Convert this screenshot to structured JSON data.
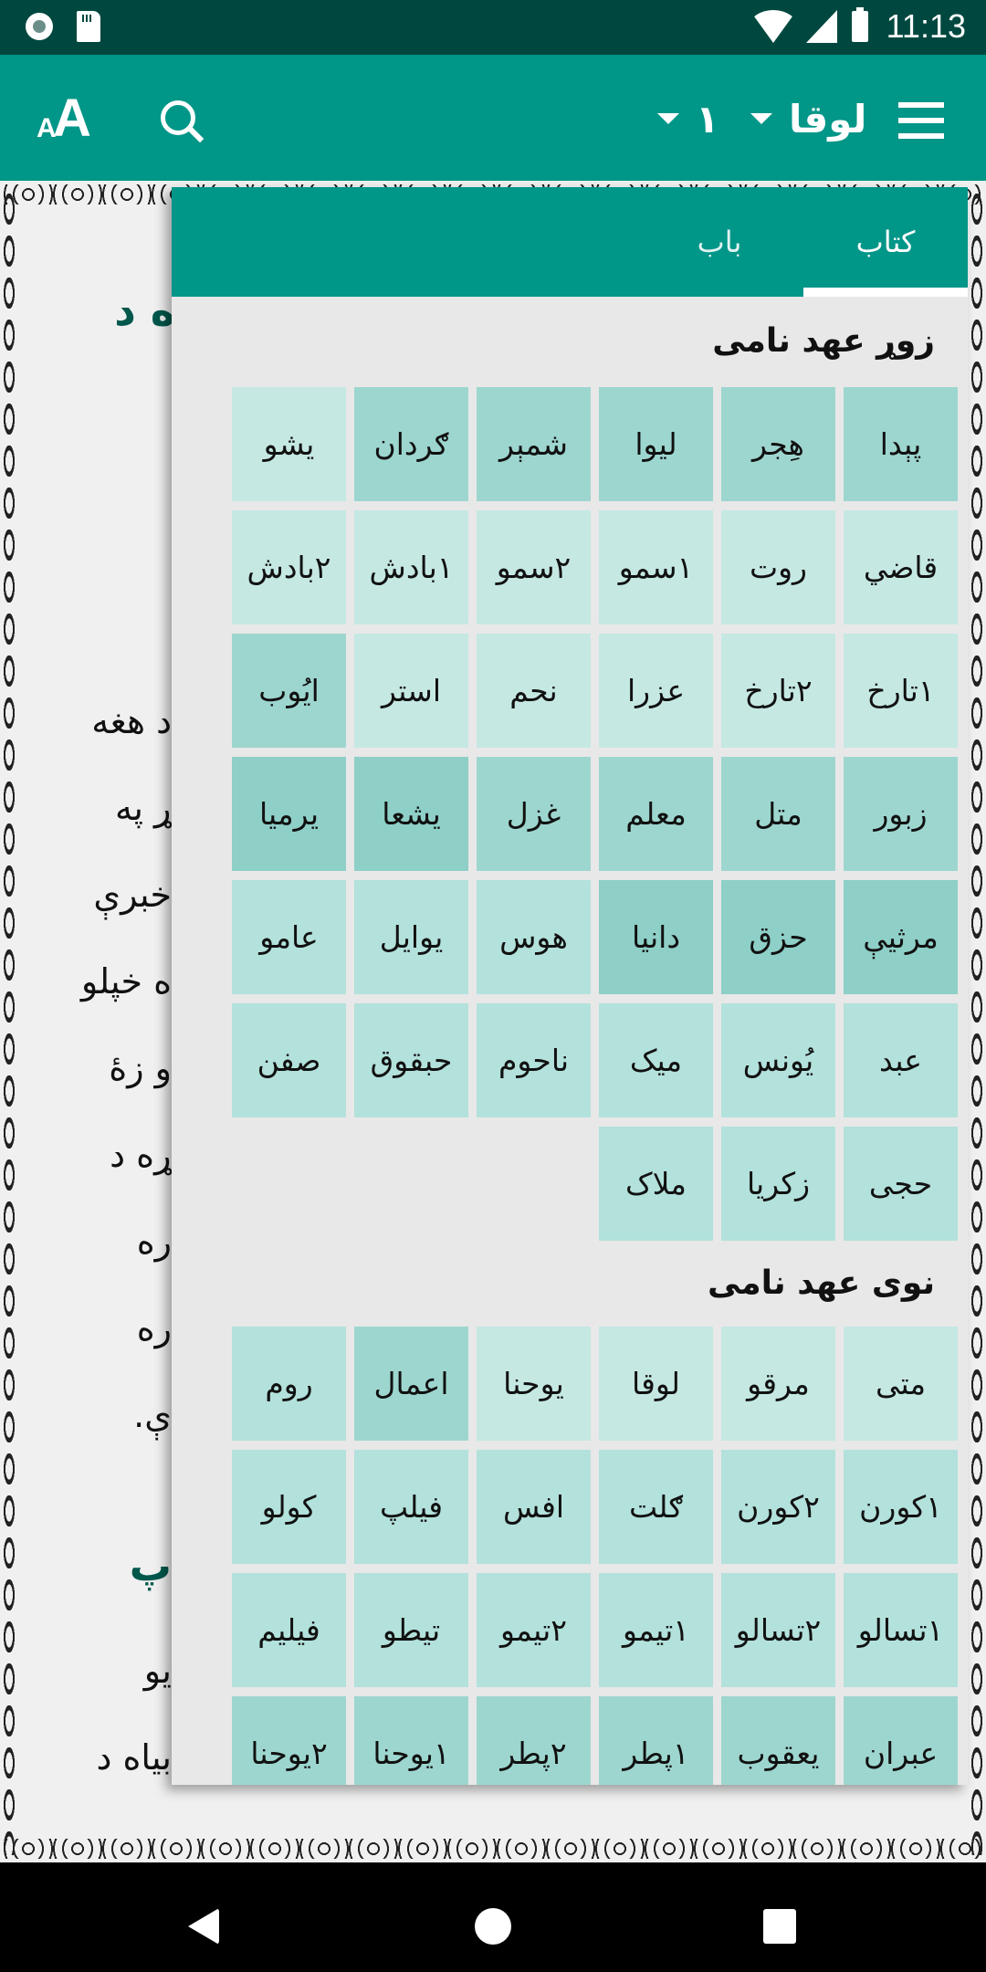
{
  "status_bar": {
    "time": "11:13",
    "icons": [
      "record-icon",
      "sd-card-icon",
      "wifi-icon",
      "signal-icon",
      "battery-icon"
    ]
  },
  "app_bar": {
    "font_size_small": "A",
    "font_size_big": "A",
    "book_selector": "لوقا",
    "chapter_selector": "١",
    "icons": [
      "font-size-icon",
      "search-icon",
      "dropdown-arrow-icon",
      "menu-icon"
    ]
  },
  "page": {
    "lines": [
      {
        "text": "ه د",
        "kind": "heading"
      },
      {
        "text": "د هغه",
        "kind": "body"
      },
      {
        "text": "ړ په",
        "kind": "body"
      },
      {
        "text": "خبرې",
        "kind": "body"
      },
      {
        "text": "ه خپلو",
        "kind": "body"
      },
      {
        "text": "و زهٔ",
        "kind": "body"
      },
      {
        "text": "ړه د",
        "kind": "body"
      },
      {
        "text": "ره",
        "kind": "body"
      },
      {
        "text": "ره",
        "kind": "body"
      },
      {
        "text": "ې.",
        "kind": "body"
      },
      {
        "text": "پ",
        "kind": "heading"
      },
      {
        "text": "یو",
        "kind": "body"
      },
      {
        "text": "بیاه د",
        "kind": "body"
      }
    ]
  },
  "panel": {
    "tabs": [
      {
        "label": "کتاب",
        "active": true
      },
      {
        "label": "باب",
        "active": false
      }
    ],
    "sections": [
      {
        "title": "زوړ عهد نامی",
        "books": [
          {
            "name": "پېدا",
            "shade": 3
          },
          {
            "name": "هِجر",
            "shade": 3
          },
          {
            "name": "ليوا",
            "shade": 3
          },
          {
            "name": "شمېر",
            "shade": 3
          },
          {
            "name": "ګردان",
            "shade": 3
          },
          {
            "name": "يشو",
            "shade": 1
          },
          {
            "name": "قاضي",
            "shade": 1
          },
          {
            "name": "روت",
            "shade": 1
          },
          {
            "name": "١سمو",
            "shade": 1
          },
          {
            "name": "٢سمو",
            "shade": 1
          },
          {
            "name": "١بادش",
            "shade": 1
          },
          {
            "name": "٢بادش",
            "shade": 1
          },
          {
            "name": "١تارخ",
            "shade": 1
          },
          {
            "name": "٢تارخ",
            "shade": 1
          },
          {
            "name": "عزرا",
            "shade": 1
          },
          {
            "name": "نحم",
            "shade": 1
          },
          {
            "name": "استر",
            "shade": 1
          },
          {
            "name": "ايُوب",
            "shade": 3
          },
          {
            "name": "زبور",
            "shade": 3
          },
          {
            "name": "متل",
            "shade": 3
          },
          {
            "name": "معلم",
            "shade": 3
          },
          {
            "name": "غزل",
            "shade": 3
          },
          {
            "name": "يشعا",
            "shade": 4
          },
          {
            "name": "يرميا",
            "shade": 4
          },
          {
            "name": "مرثيې",
            "shade": 4
          },
          {
            "name": "حزق",
            "shade": 4
          },
          {
            "name": "دانيا",
            "shade": 4
          },
          {
            "name": "هوس",
            "shade": 2
          },
          {
            "name": "يوايل",
            "shade": 2
          },
          {
            "name": "عامو",
            "shade": 2
          },
          {
            "name": "عبد",
            "shade": 2
          },
          {
            "name": "يُونس",
            "shade": 2
          },
          {
            "name": "ميک",
            "shade": 2
          },
          {
            "name": "ناحوم",
            "shade": 2
          },
          {
            "name": "حبقوق",
            "shade": 2
          },
          {
            "name": "صفن",
            "shade": 2
          },
          {
            "name": "حجی",
            "shade": 2
          },
          {
            "name": "زکريا",
            "shade": 2
          },
          {
            "name": "ملاک",
            "shade": 2
          }
        ]
      },
      {
        "title": "نوی عهد نامی",
        "books": [
          {
            "name": "متی",
            "shade": 1
          },
          {
            "name": "مرقو",
            "shade": 1
          },
          {
            "name": "لوقا",
            "shade": 1
          },
          {
            "name": "يوحنا",
            "shade": 1
          },
          {
            "name": "اعمال",
            "shade": 3
          },
          {
            "name": "روم",
            "shade": 2
          },
          {
            "name": "١کورن",
            "shade": 2
          },
          {
            "name": "٢کورن",
            "shade": 2
          },
          {
            "name": "ګلت",
            "shade": 2
          },
          {
            "name": "افس",
            "shade": 2
          },
          {
            "name": "فيلپ",
            "shade": 2
          },
          {
            "name": "کولو",
            "shade": 2
          },
          {
            "name": "١تسالو",
            "shade": 2
          },
          {
            "name": "٢تسالو",
            "shade": 2
          },
          {
            "name": "١تيمو",
            "shade": 2
          },
          {
            "name": "٢تيمو",
            "shade": 2
          },
          {
            "name": "تيطو",
            "shade": 2
          },
          {
            "name": "فيليم",
            "shade": 2
          },
          {
            "name": "عبران",
            "shade": 3
          },
          {
            "name": "يعقوب",
            "shade": 3
          },
          {
            "name": "١پطر",
            "shade": 3
          },
          {
            "name": "٢پطر",
            "shade": 3
          },
          {
            "name": "١يوحنا",
            "shade": 3
          },
          {
            "name": "٢يوحنا",
            "shade": 3
          }
        ]
      }
    ]
  },
  "nav_bar": {
    "icons": [
      "back-icon",
      "home-icon",
      "recents-icon"
    ]
  },
  "colors": {
    "status_bar": "#00483f",
    "primary": "#009688",
    "heading_text": "#00574b",
    "panel_bg": "#e8e8e8",
    "tile_shades": [
      "#c5e8e3",
      "#b3e1db",
      "#9dd6cf",
      "#8ecfc7"
    ]
  }
}
